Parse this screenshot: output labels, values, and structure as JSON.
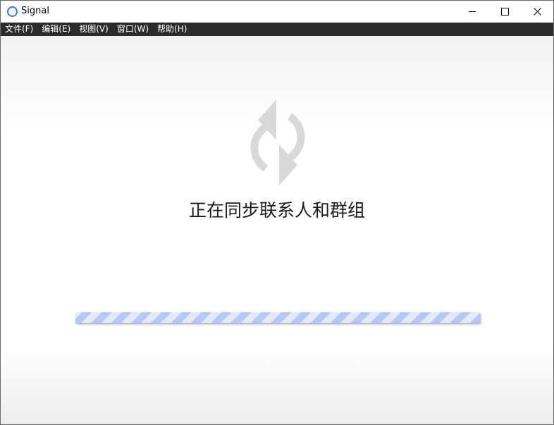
{
  "window": {
    "title": "Signal"
  },
  "menubar": {
    "items": [
      {
        "label": "文件(F)"
      },
      {
        "label": "编辑(E)"
      },
      {
        "label": "视图(V)"
      },
      {
        "label": "窗口(W)"
      },
      {
        "label": "帮助(H)"
      }
    ]
  },
  "main": {
    "status_icon": "sync-icon",
    "status_text": "正在同步联系人和群组",
    "progress_style": "indeterminate-striped"
  },
  "colors": {
    "menubar_bg": "#2b2b2b",
    "accent": "#3a76f0",
    "progress_stripe_light": "#e3eafb",
    "progress_stripe_dark": "#b5c8f7",
    "sync_icon": "#d9d9d9"
  }
}
